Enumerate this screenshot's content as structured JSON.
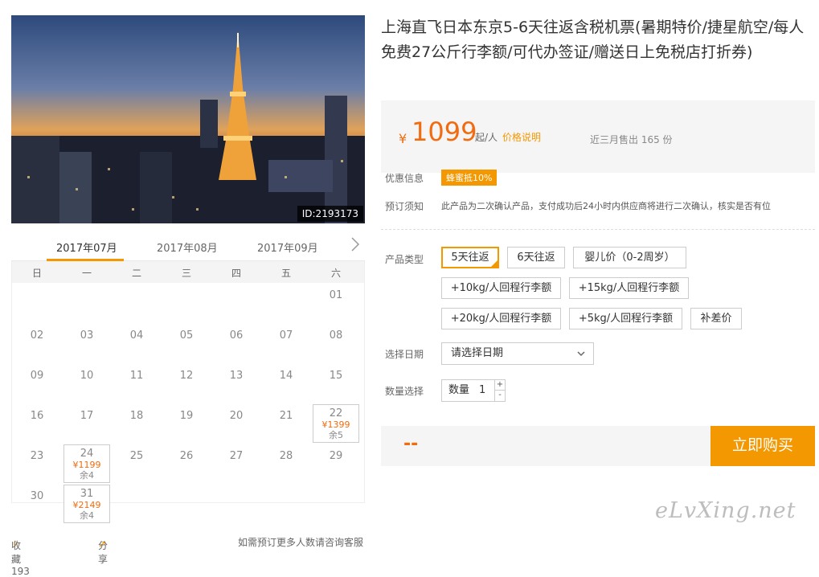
{
  "hero": {
    "id_label": "ID:2193173"
  },
  "calendar": {
    "months": [
      "2017年07月",
      "2017年08月",
      "2017年09月"
    ],
    "weekdays": [
      "日",
      "一",
      "二",
      "三",
      "四",
      "五",
      "六"
    ],
    "days": [
      {
        "d": "01"
      },
      {
        "d": "02"
      },
      {
        "d": "03"
      },
      {
        "d": "04"
      },
      {
        "d": "05"
      },
      {
        "d": "06"
      },
      {
        "d": "07"
      },
      {
        "d": "08"
      },
      {
        "d": "09"
      },
      {
        "d": "10"
      },
      {
        "d": "11"
      },
      {
        "d": "12"
      },
      {
        "d": "13"
      },
      {
        "d": "14"
      },
      {
        "d": "15"
      },
      {
        "d": "16"
      },
      {
        "d": "17"
      },
      {
        "d": "18"
      },
      {
        "d": "19"
      },
      {
        "d": "20"
      },
      {
        "d": "21"
      },
      {
        "d": "22",
        "price": "¥1399",
        "rem": "余5"
      },
      {
        "d": "23"
      },
      {
        "d": "24",
        "price": "¥1199",
        "rem": "余4"
      },
      {
        "d": "25"
      },
      {
        "d": "26"
      },
      {
        "d": "27"
      },
      {
        "d": "28"
      },
      {
        "d": "29"
      },
      {
        "d": "30"
      },
      {
        "d": "31",
        "price": "¥2149",
        "rem": "余4"
      }
    ]
  },
  "bottom": {
    "fav": "收藏 193",
    "share": "分享",
    "note": "如需预订更多人数请咨询客服"
  },
  "product": {
    "title": "上海直飞日本东京5-6天往返含税机票(暑期特价/捷星航空/每人免费27公斤行李额/可代办签证/赠送日上免税店打折券)",
    "yen": "¥",
    "price": "1099",
    "per": "起/人",
    "price_note": "价格说明",
    "sold": "近三月售出 165 份",
    "promo_label": "优惠信息",
    "promo_badge": "蜂蜜抵10%",
    "notice_label": "预订须知",
    "notice": "此产品为二次确认产品，支付成功后24小时内供应商将进行二次确认，核实是否有位",
    "type_label": "产品类型",
    "options": [
      "5天往返",
      "6天往返",
      "婴儿价（0-2周岁）",
      "+10kg/人回程行李额",
      "+15kg/人回程行李额",
      "+20kg/人回程行李额",
      "+5kg/人回程行李额",
      "补差价"
    ],
    "date_label": "选择日期",
    "date_placeholder": "请选择日期",
    "qty_label": "数量选择",
    "qty_text": "数量",
    "qty_value": "1",
    "plus": "+",
    "minus": "-",
    "total": "--",
    "buy": "立即购买"
  },
  "watermark": "eLvXing.net",
  "colors": {
    "accent": "#f39800",
    "price": "#f26b0f"
  }
}
